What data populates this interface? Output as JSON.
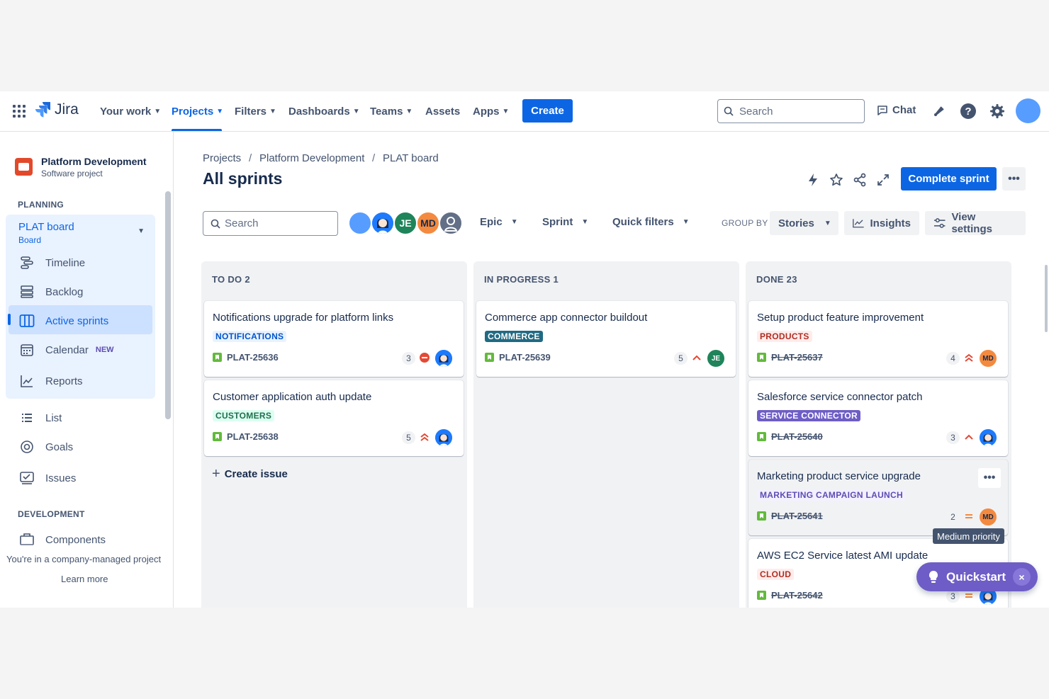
{
  "nav": {
    "product": "Jira",
    "items": [
      {
        "label": "Your work",
        "dropdown": true
      },
      {
        "label": "Projects",
        "dropdown": true,
        "active": true
      },
      {
        "label": "Filters",
        "dropdown": true
      },
      {
        "label": "Dashboards",
        "dropdown": true
      },
      {
        "label": "Teams",
        "dropdown": true
      },
      {
        "label": "Assets",
        "dropdown": false
      },
      {
        "label": "Apps",
        "dropdown": true
      }
    ],
    "create_label": "Create",
    "search_placeholder": "Search",
    "chat_label": "Chat"
  },
  "sidebar": {
    "project_name": "Platform Development",
    "project_type": "Software project",
    "planning_heading": "PLANNING",
    "board_name": "PLAT board",
    "board_sub": "Board",
    "planning_items": [
      {
        "label": "Timeline",
        "icon": "timeline-icon"
      },
      {
        "label": "Backlog",
        "icon": "backlog-icon"
      },
      {
        "label": "Active sprints",
        "icon": "board-icon",
        "active": true
      },
      {
        "label": "Calendar",
        "icon": "calendar-icon",
        "badge": "NEW"
      },
      {
        "label": "Reports",
        "icon": "reports-icon"
      }
    ],
    "other_items": [
      {
        "label": "List",
        "icon": "list-icon"
      },
      {
        "label": "Goals",
        "icon": "goals-icon"
      },
      {
        "label": "Issues",
        "icon": "issues-icon"
      }
    ],
    "development_heading": "DEVELOPMENT",
    "development_items": [
      {
        "label": "Components",
        "icon": "components-icon"
      }
    ],
    "footer_note": "You're in a company-managed project",
    "learn_more": "Learn more"
  },
  "breadcrumb": [
    "Projects",
    "Platform Development",
    "PLAT board"
  ],
  "page_title": "All sprints",
  "header": {
    "complete_sprint_label": "Complete sprint",
    "more_label": "•••"
  },
  "filters": {
    "search_placeholder": "Search",
    "avatars": [
      {
        "initials": "",
        "color": "#579dff"
      },
      {
        "initials": "",
        "color": "#1d7afc",
        "illustrated": true
      },
      {
        "initials": "JE",
        "color": "#1f845a"
      },
      {
        "initials": "MD",
        "color": "#f38a3f"
      },
      {
        "initials": "",
        "color": "#626f86",
        "generic": true
      }
    ],
    "epic_label": "Epic",
    "sprint_label": "Sprint",
    "quick_filters_label": "Quick filters",
    "group_by_label": "GROUP BY",
    "group_by_value": "Stories",
    "insights_label": "Insights",
    "view_settings_label": "View settings"
  },
  "columns": [
    {
      "title": "TO DO 2",
      "cards": [
        {
          "title": "Notifications upgrade for platform links",
          "label": "NOTIFICATIONS",
          "label_bg": "#e9f2ff",
          "label_fg": "#0055cc",
          "key": "PLAT-25636",
          "estimate": "3",
          "priority": "blocker",
          "assignee": {
            "initials": "",
            "color": "#1d7afc",
            "illustrated": true
          },
          "done": false
        },
        {
          "title": "Customer application auth update",
          "label": "CUSTOMERS",
          "label_bg": "#dcfff1",
          "label_fg": "#216e4e",
          "key": "PLAT-25638",
          "estimate": "5",
          "priority": "highest",
          "assignee": {
            "initials": "",
            "color": "#1d7afc",
            "illustrated": true
          },
          "done": false
        }
      ],
      "create_label": "Create issue"
    },
    {
      "title": "IN PROGRESS 1",
      "cards": [
        {
          "title": "Commerce app connector buildout",
          "label": "COMMERCE",
          "label_bg": "#206a83",
          "label_fg": "#ffffff",
          "key": "PLAT-25639",
          "estimate": "5",
          "priority": "high",
          "assignee": {
            "initials": "JE",
            "color": "#1f845a"
          },
          "done": false
        }
      ]
    },
    {
      "title": "DONE 23",
      "cards": [
        {
          "title": "Setup product feature improvement",
          "label": "PRODUCTS",
          "label_bg": "#ffeceb",
          "label_fg": "#ae2e24",
          "key": "PLAT-25637",
          "estimate": "4",
          "priority": "highest",
          "assignee": {
            "initials": "MD",
            "color": "#f38a3f"
          },
          "done": true
        },
        {
          "title": "Salesforce service connector patch",
          "label": "SERVICE CONNECTOR",
          "label_bg": "#6e5dc6",
          "label_fg": "#ffffff",
          "key": "PLAT-25640",
          "estimate": "3",
          "priority": "high",
          "assignee": {
            "initials": "",
            "color": "#1d7afc",
            "illustrated": true
          },
          "done": true
        },
        {
          "title": "Marketing product service upgrade",
          "label": "MARKETING CAMPAIGN LAUNCH",
          "label_bg": "#f3f0ff",
          "label_fg": "#5e4db2",
          "key": "PLAT-25641",
          "estimate": "2",
          "priority": "medium",
          "assignee": {
            "initials": "MD",
            "color": "#f38a3f"
          },
          "done": true,
          "hovered": true
        },
        {
          "title": "AWS EC2 Service latest AMI update",
          "label": "CLOUD",
          "label_bg": "#ffeceb",
          "label_fg": "#ae2e24",
          "key": "PLAT-25642",
          "estimate": "3",
          "priority": "medium",
          "assignee": {
            "initials": "",
            "color": "#1d7afc",
            "illustrated": true
          },
          "done": true
        }
      ]
    }
  ],
  "tooltip": "Medium priority",
  "quickstart_label": "Quickstart",
  "quickstart_close": "×"
}
